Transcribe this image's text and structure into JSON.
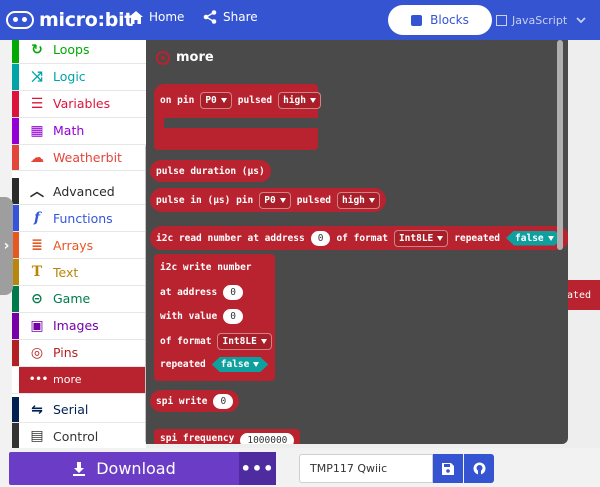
{
  "header": {
    "logo_text": "micro:bit",
    "home_label": "Home",
    "share_label": "Share",
    "mode_blocks": "Blocks",
    "mode_javascript": "JavaScript",
    "bg_color": "#3454d1"
  },
  "toolbox": {
    "categories": [
      {
        "label": "Loops",
        "color": "#00aa00",
        "icon": "loops-icon"
      },
      {
        "label": "Logic",
        "color": "#00a4a6",
        "icon": "logic-icon"
      },
      {
        "label": "Variables",
        "color": "#dc143c",
        "icon": "variables-icon"
      },
      {
        "label": "Math",
        "color": "#9400d3",
        "icon": "math-icon"
      },
      {
        "label": "Weatherbit",
        "color": "#e2463b",
        "icon": "weatherbit-icon"
      },
      {
        "label": "Advanced",
        "color": "#2b2b2b",
        "icon": "chevron-up-icon"
      },
      {
        "label": "Functions",
        "color": "#3455db",
        "icon": "functions-icon"
      },
      {
        "label": "Arrays",
        "color": "#e65722",
        "icon": "arrays-icon"
      },
      {
        "label": "Text",
        "color": "#b8860b",
        "icon": "text-icon"
      },
      {
        "label": "Game",
        "color": "#007a4b",
        "icon": "game-icon"
      },
      {
        "label": "Images",
        "color": "#7600a8",
        "icon": "images-icon"
      },
      {
        "label": "Pins",
        "color": "#b22222",
        "icon": "pins-icon"
      },
      {
        "label": "more",
        "color": "#b8232f",
        "icon": "more-dots-icon"
      },
      {
        "label": "Serial",
        "color": "#002050",
        "icon": "serial-icon"
      },
      {
        "label": "Control",
        "color": "#333333",
        "icon": "control-icon"
      }
    ]
  },
  "flyout": {
    "title": "more",
    "on_pin": {
      "label": "on pin",
      "pin": "P0",
      "pulsed": "pulsed",
      "level": "high"
    },
    "pulse_duration": "pulse duration (µs)",
    "pulse_in": {
      "label": "pulse in (µs) pin",
      "pin": "P0",
      "pulsed": "pulsed",
      "level": "high"
    },
    "i2c_read": {
      "label": "i2c read number at address",
      "address": "0",
      "of_format": "of format",
      "format": "Int8LE",
      "repeated": "repeated",
      "repeated_value": "false"
    },
    "i2c_write": {
      "label": "i2c write number",
      "at_address": "at address",
      "address": "0",
      "with_value": "with value",
      "value": "0",
      "of_format": "of format",
      "format": "Int8LE",
      "repeated": "repeated",
      "repeated_value": "false"
    },
    "spi_write": {
      "label": "spi write",
      "value": "0"
    },
    "spi_frequency": {
      "label": "spi frequency",
      "value": "1000000"
    }
  },
  "workspace": {
    "partial_block_text": "ated"
  },
  "bottom": {
    "download_label": "Download",
    "more_label": "•••",
    "project_name": "TMP117 Qwiic"
  }
}
